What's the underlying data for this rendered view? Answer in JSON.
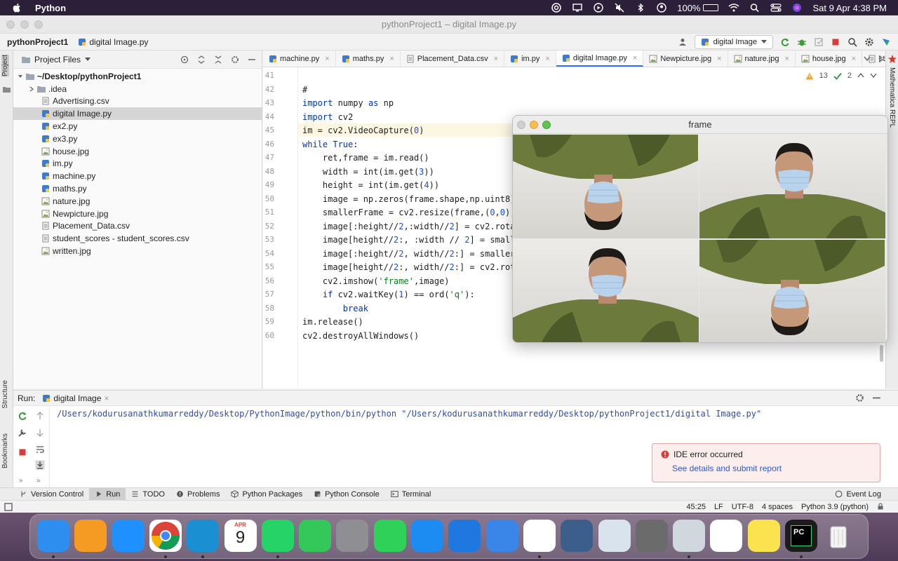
{
  "menubar": {
    "app_name": "Python",
    "battery_percent": "100%",
    "battery_level": 1.0,
    "datetime": "Sat 9 Apr  4:38 PM"
  },
  "window": {
    "title": "pythonProject1 – digital Image.py"
  },
  "navbar": {
    "project": "pythonProject1",
    "file": "digital Image.py",
    "run_config": "digital Image"
  },
  "left_strip": {
    "project_tab": "Project",
    "structure_tab": "Structure",
    "bookmarks_tab": "Bookmarks"
  },
  "right_strip": {
    "tab": "Mathematica REPL"
  },
  "project_panel": {
    "title": "Project Files",
    "root": "~/Desktop/pythonProject1",
    "items": [
      {
        "name": ".idea",
        "type": "folder"
      },
      {
        "name": "Advertising.csv",
        "type": "csv"
      },
      {
        "name": "digital Image.py",
        "type": "py",
        "selected": true
      },
      {
        "name": "ex2.py",
        "type": "py"
      },
      {
        "name": "ex3.py",
        "type": "py"
      },
      {
        "name": "house.jpg",
        "type": "jpg"
      },
      {
        "name": "im.py",
        "type": "py"
      },
      {
        "name": "machine.py",
        "type": "py"
      },
      {
        "name": "maths.py",
        "type": "py"
      },
      {
        "name": "nature.jpg",
        "type": "jpg"
      },
      {
        "name": "Newpicture.jpg",
        "type": "jpg"
      },
      {
        "name": "Placement_Data.csv",
        "type": "csv"
      },
      {
        "name": "student_scores - student_scores.csv",
        "type": "csv"
      },
      {
        "name": "written.jpg",
        "type": "jpg"
      }
    ]
  },
  "editor": {
    "tabs": [
      {
        "label": "machine.py",
        "type": "py"
      },
      {
        "label": "maths.py",
        "type": "py"
      },
      {
        "label": "Placement_Data.csv",
        "type": "csv"
      },
      {
        "label": "im.py",
        "type": "py"
      },
      {
        "label": "digital Image.py",
        "type": "py",
        "active": true
      },
      {
        "label": "Newpicture.jpg",
        "type": "jpg"
      },
      {
        "label": "nature.jpg",
        "type": "jpg"
      },
      {
        "label": "house.jpg",
        "type": "jpg"
      },
      {
        "label": "stu",
        "type": "csv"
      }
    ],
    "warnings": "13",
    "checks": "2",
    "current_line": "45",
    "lines": [
      {
        "n": "41",
        "text": ""
      },
      {
        "n": "42",
        "text": "#"
      },
      {
        "n": "43",
        "text": "import numpy as np"
      },
      {
        "n": "44",
        "text": "import cv2"
      },
      {
        "n": "45",
        "text": "im = cv2.VideoCapture(0)"
      },
      {
        "n": "46",
        "text": "while True:"
      },
      {
        "n": "47",
        "text": "    ret,frame = im.read()"
      },
      {
        "n": "48",
        "text": "    width = int(im.get(3))"
      },
      {
        "n": "49",
        "text": "    height = int(im.get(4))"
      },
      {
        "n": "50",
        "text": "    image = np.zeros(frame.shape,np.uint8)"
      },
      {
        "n": "51",
        "text": "    smallerFrame = cv2.resize(frame,(0,0),f"
      },
      {
        "n": "52",
        "text": "    image[:height//2,:width//2] = cv2.rotat"
      },
      {
        "n": "53",
        "text": "    image[height//2:, :width // 2] = smalle"
      },
      {
        "n": "54",
        "text": "    image[:height//2, width//2:] = smallerF"
      },
      {
        "n": "55",
        "text": "    image[height//2:, width//2:] = cv2.rota"
      },
      {
        "n": "56",
        "text": "    cv2.imshow('frame',image)"
      },
      {
        "n": "57",
        "text": "    if cv2.waitKey(1) == ord('q'):"
      },
      {
        "n": "58",
        "text": "        break"
      },
      {
        "n": "59",
        "text": "im.release()"
      },
      {
        "n": "60",
        "text": "cv2.destroyAllWindows()"
      }
    ]
  },
  "frame_window": {
    "title": "frame"
  },
  "run_panel": {
    "label": "Run:",
    "tab": "digital Image",
    "output": "/Users/kodurusanathkumarreddy/Desktop/PythonImage/python/bin/python \"/Users/kodurusanathkumarreddy/Desktop/pythonProject1/digital Image.py\""
  },
  "error_toast": {
    "title": "IDE error occurred",
    "link": "See details and submit report"
  },
  "bottom_tabs": [
    {
      "label": "Version Control",
      "icon": "branch-icon"
    },
    {
      "label": "Run",
      "icon": "run-icon",
      "active": true
    },
    {
      "label": "TODO",
      "icon": "list-icon"
    },
    {
      "label": "Problems",
      "icon": "problems-icon"
    },
    {
      "label": "Python Packages",
      "icon": "packages-icon"
    },
    {
      "label": "Python Console",
      "icon": "console-icon"
    },
    {
      "label": "Terminal",
      "icon": "terminal-icon"
    }
  ],
  "event_log": "Event Log",
  "status": {
    "position": "45:25",
    "line_sep": "LF",
    "encoding": "UTF-8",
    "indent": "4 spaces",
    "interpreter": "Python 3.9 (python)"
  },
  "dock": {
    "calendar_month": "APR",
    "calendar_day": "9",
    "apps": [
      {
        "name": "finder",
        "color": "#2d8ef0",
        "running": true
      },
      {
        "name": "pages",
        "color": "#f59a23",
        "running": false
      },
      {
        "name": "safari",
        "color": "#1e90ff",
        "running": false
      },
      {
        "name": "chrome",
        "color": "#ffffff",
        "running": true
      },
      {
        "name": "edge",
        "color": "#1a8fd1",
        "running": true
      },
      {
        "name": "calendar",
        "color": "#ffffff",
        "running": false
      },
      {
        "name": "whatsapp",
        "color": "#25d366",
        "running": true
      },
      {
        "name": "messages",
        "color": "#34c759",
        "running": false
      },
      {
        "name": "system-preferences",
        "color": "#8e8e93",
        "running": false
      },
      {
        "name": "facetime",
        "color": "#30d158",
        "running": false
      },
      {
        "name": "app-store",
        "color": "#1c8cf2",
        "running": false
      },
      {
        "name": "xcode",
        "color": "#1f78e0",
        "running": false
      },
      {
        "name": "xcode-tools",
        "color": "#3a86e8",
        "running": false
      },
      {
        "name": "vscode",
        "color": "#ffffff",
        "running": true
      },
      {
        "name": "kali",
        "color": "#3b5f8a",
        "running": false
      },
      {
        "name": "preview",
        "color": "#d9e3ee",
        "running": false
      },
      {
        "name": "rocket",
        "color": "#6b6b6b",
        "running": false
      },
      {
        "name": "parallels",
        "color": "#d0d7df",
        "running": true
      },
      {
        "name": "office",
        "color": "#ffffff",
        "running": false
      },
      {
        "name": "notes",
        "color": "#fbe24f",
        "running": false
      },
      {
        "name": "pycharm",
        "color": "#1c1c1c",
        "running": true
      },
      {
        "name": "trash",
        "color": "#e9e9e9",
        "running": false
      }
    ]
  }
}
